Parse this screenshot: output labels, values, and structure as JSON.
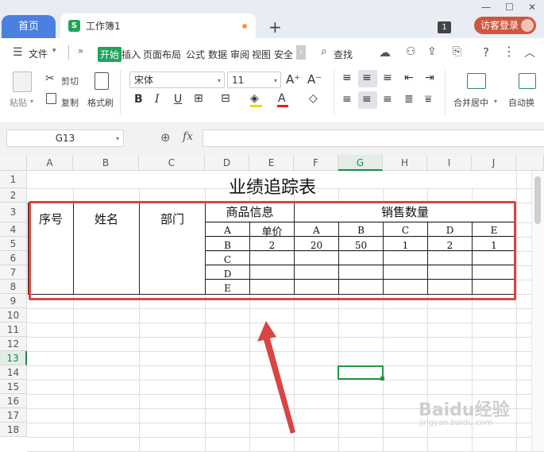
{
  "tabs": {
    "home": "首页",
    "workbook": "工作簿1",
    "workbook_icon": "S",
    "add": "+",
    "window_count": "1",
    "login": "访客登录"
  },
  "menu": {
    "file": "文件",
    "items": [
      "开始",
      "插入",
      "页面布局",
      "公式",
      "数据",
      "审阅",
      "视图",
      "安全"
    ],
    "search": "查找"
  },
  "ribbon": {
    "paste": "粘贴",
    "cut": "剪切",
    "copy": "复制",
    "format_painter": "格式刷",
    "font_name": "宋体",
    "font_size": "11",
    "merge_center": "合并居中",
    "auto_wrap": "自动换"
  },
  "formula_bar": {
    "name_box": "G13",
    "fx": "fx",
    "formula": ""
  },
  "sheet": {
    "columns": [
      "A",
      "B",
      "C",
      "D",
      "E",
      "F",
      "G",
      "H",
      "I",
      "J"
    ],
    "rows": [
      "1",
      "2",
      "3",
      "4",
      "5",
      "6",
      "7",
      "8",
      "9",
      "10",
      "11",
      "12",
      "13",
      "14",
      "15",
      "16",
      "17",
      "18"
    ],
    "selected_cell": "G13",
    "title": "业绩追踪表",
    "headers": {
      "seq": "序号",
      "name": "姓名",
      "dept": "部门",
      "product_info": "商品信息",
      "unit_price": "单价",
      "sales_qty": "销售数量"
    },
    "product_col": [
      "A",
      "B",
      "C",
      "D",
      "E"
    ],
    "sales_cols": [
      "A",
      "B",
      "C",
      "D",
      "E"
    ],
    "row4": {
      "price": "2",
      "qty": [
        "20",
        "50",
        "1",
        "2",
        "1"
      ]
    }
  },
  "watermark": {
    "main": "Baidu经验",
    "sub": "jingyan.baidu.com"
  },
  "colors": {
    "accent_green": "#1e9a46",
    "highlight_red": "#d84545",
    "tab_blue": "#4b7fe0"
  }
}
